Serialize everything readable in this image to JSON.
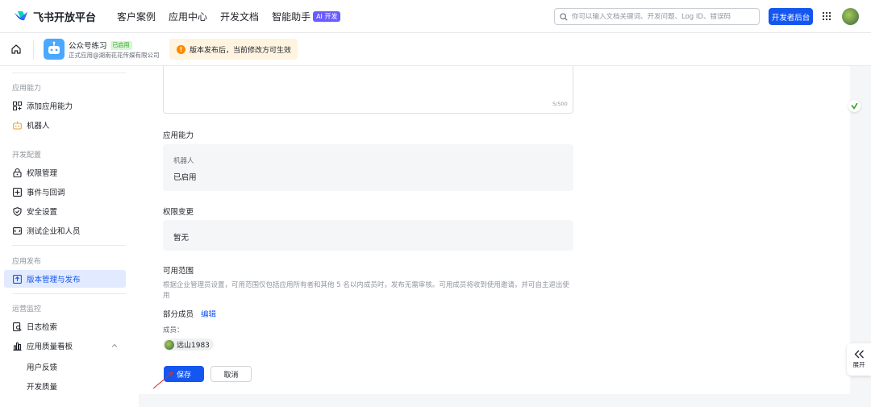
{
  "topbar": {
    "logo_text": "飞书开放平台",
    "nav": [
      {
        "label": "客户案例"
      },
      {
        "label": "应用中心"
      },
      {
        "label": "开发文档"
      },
      {
        "label": "智能助手",
        "badge": "AI 开发"
      }
    ],
    "search_placeholder": "你可以输入文档关键词、开发问题、Log ID、错误码",
    "dev_console_label": "开发者后台"
  },
  "subbar": {
    "app_name": "公众号练习",
    "app_status": "已启用",
    "app_subtitle": "正式应用@湖南花花传媒有限公司",
    "notice": "版本发布后，当前修改方可生效"
  },
  "sidebar": {
    "sections": [
      {
        "title": "应用能力",
        "items": [
          {
            "label": "添加应用能力",
            "icon": "grid-add-icon"
          },
          {
            "label": "机器人",
            "icon": "robot-icon"
          }
        ]
      },
      {
        "title": "开发配置",
        "items": [
          {
            "label": "权限管理",
            "icon": "lock-icon"
          },
          {
            "label": "事件与回调",
            "icon": "event-icon"
          },
          {
            "label": "安全设置",
            "icon": "shield-icon"
          },
          {
            "label": "测试企业和人员",
            "icon": "test-icon"
          }
        ]
      },
      {
        "title": "应用发布",
        "items": [
          {
            "label": "版本管理与发布",
            "icon": "upload-icon",
            "active": true
          }
        ]
      },
      {
        "title": "运营监控",
        "items": [
          {
            "label": "日志检索",
            "icon": "log-search-icon"
          },
          {
            "label": "应用质量看板",
            "icon": "chart-icon"
          }
        ],
        "subitems": [
          {
            "label": "用户反馈"
          },
          {
            "label": "开发质量"
          }
        ]
      }
    ]
  },
  "form": {
    "char_count": "5/500",
    "capability": {
      "label": "应用能力",
      "item_title": "机器人",
      "item_status": "已启用"
    },
    "permission": {
      "label": "权限变更",
      "value": "暂无"
    },
    "scope": {
      "label": "可用范围",
      "description": "根据企业管理员设置，可用范围仅包括应用所有者和其他 5 名以内成员时，发布无需审核。可用成员将收到使用邀请，并可自主退出使用",
      "partial_members": "部分成员",
      "edit_label": "编辑",
      "members_label": "成员：",
      "members": [
        {
          "name": "远山1983"
        }
      ]
    },
    "save_label": "保存",
    "cancel_label": "取消"
  },
  "expand_label": "展开",
  "colors": {
    "primary": "#1456f0",
    "notice_bg": "#fef4e0",
    "enabled_green": "#2ea121"
  }
}
